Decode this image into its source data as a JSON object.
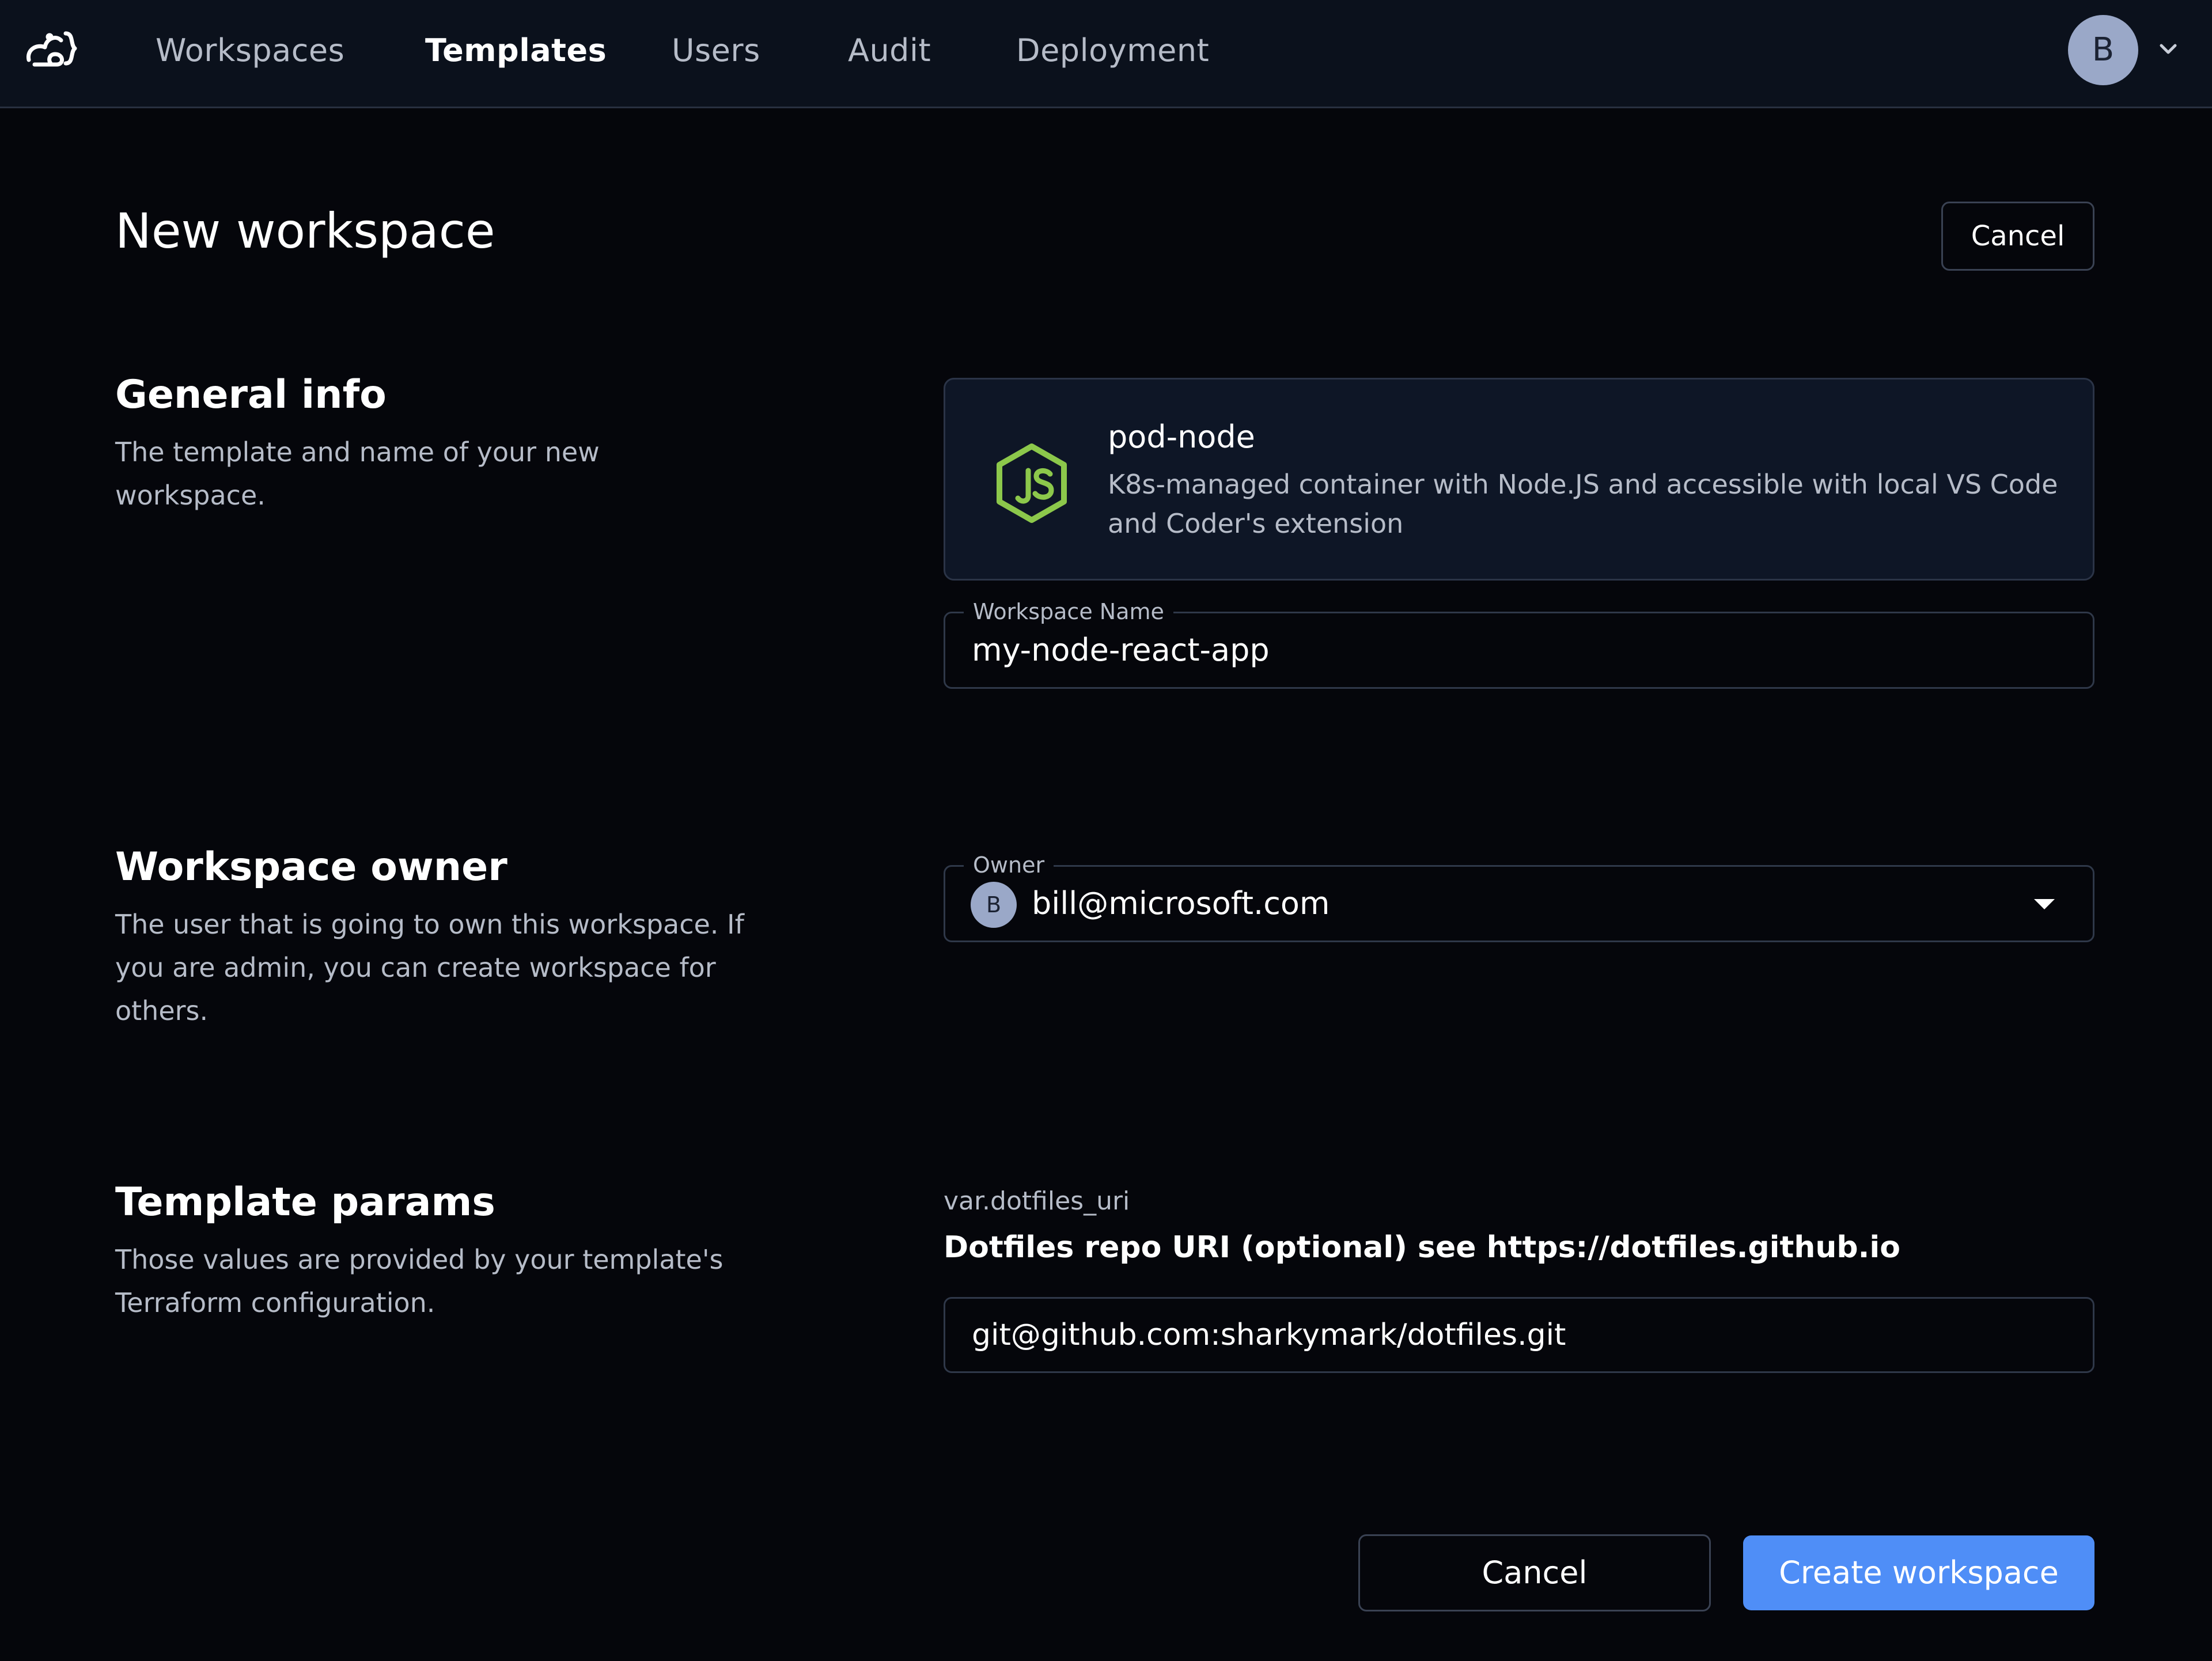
{
  "nav": {
    "links": [
      {
        "label": "Workspaces"
      },
      {
        "label": "Templates"
      },
      {
        "label": "Users"
      },
      {
        "label": "Audit"
      },
      {
        "label": "Deployment"
      }
    ],
    "active": "Templates",
    "user_initial": "B"
  },
  "header": {
    "title": "New workspace",
    "cancel_label": "Cancel"
  },
  "general_info": {
    "title": "General info",
    "description": "The template and name of your new workspace."
  },
  "template": {
    "name": "pod-node",
    "description": "K8s-managed container with Node.JS and accessible with local VS Code and Coder's extension",
    "icon": "nodejs-icon"
  },
  "workspace_name": {
    "label": "Workspace Name",
    "value": "my-node-react-app"
  },
  "owner_section": {
    "title": "Workspace owner",
    "description": "The user that is going to own this workspace. If you are admin, you can create workspace for others."
  },
  "owner_field": {
    "label": "Owner",
    "avatar_initial": "B",
    "value": "bill@microsoft.com"
  },
  "params_section": {
    "title": "Template params",
    "description": "Those values are provided by your template's Terraform configuration."
  },
  "param": {
    "var_name": "var.dotfiles_uri",
    "description": "Dotfiles repo URI (optional) see https://dotfiles.github.io",
    "value": "git@github.com:sharkymark/dotfiles.git"
  },
  "footer": {
    "cancel_label": "Cancel",
    "create_label": "Create workspace"
  },
  "colors": {
    "background": "#05060b",
    "navbar": "#0b111c",
    "primary": "#4f8ef7",
    "nodejs_green": "#8cc84b"
  }
}
